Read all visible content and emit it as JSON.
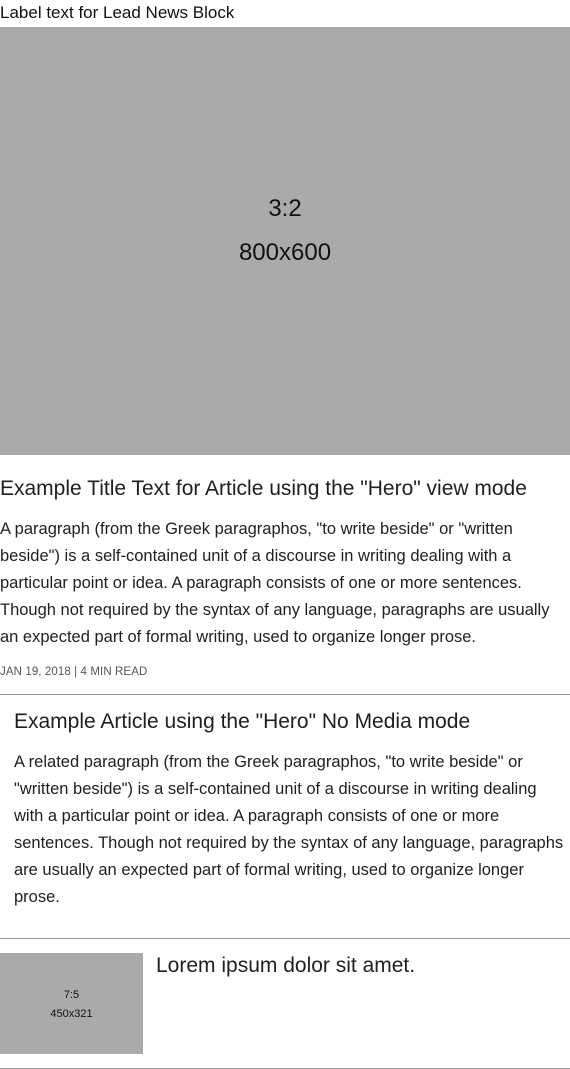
{
  "lead_block": {
    "label": "Label text for Lead News Block"
  },
  "hero": {
    "media": {
      "ratio": "3:2",
      "size": "800x600"
    },
    "title": "Example Title Text for Article using the \"Hero\" view mode",
    "body": "A paragraph (from the Greek paragraphos, \"to write beside\" or \"written beside\") is a self-contained unit of a discourse in writing dealing with a particular point or idea. A paragraph consists of one or more sentences. Though not required by the syntax of any language, paragraphs are usually an expected part of formal writing, used to organize longer prose.",
    "meta": "JAN 19, 2018 | 4 MIN READ"
  },
  "hero_no_media": {
    "title": "Example Article using the \"Hero\" No Media mode",
    "body": "A related paragraph (from the Greek paragraphos, \"to write beside\" or \"written beside\") is a self-contained unit of a discourse in writing dealing with a particular point or idea. A paragraph consists of one or more sentences. Though not required by the syntax of any language, paragraphs are usually an expected part of formal writing, used to organize longer prose."
  },
  "thumb_article": {
    "media": {
      "ratio": "7:5",
      "size": "450x321"
    },
    "title": "Lorem ipsum dolor sit amet."
  },
  "colors": {
    "placeholder_bg": "#aaaaaa",
    "divider": "#9a9a9a",
    "text": "#1f1f1f",
    "meta": "#555555"
  }
}
